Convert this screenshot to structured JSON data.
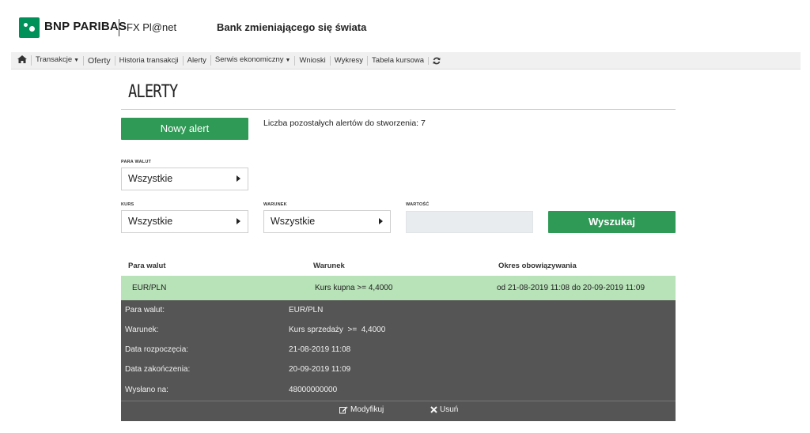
{
  "header": {
    "bank_name": "BNP PARIBAS",
    "product_name": "FX Pl@net",
    "tagline": "Bank zmieniającego się świata"
  },
  "nav": {
    "items": [
      {
        "label": "Transakcje",
        "dropdown": true
      },
      {
        "label": "Oferty",
        "dropdown": false
      },
      {
        "label": "Historia transakcji",
        "dropdown": false
      },
      {
        "label": "Alerty",
        "dropdown": false
      },
      {
        "label": "Serwis ekonomiczny",
        "dropdown": true
      },
      {
        "label": "Wnioski",
        "dropdown": false
      },
      {
        "label": "Wykresy",
        "dropdown": false
      },
      {
        "label": "Tabela kursowa",
        "dropdown": false
      }
    ]
  },
  "page": {
    "title": "ALERTY",
    "new_alert_button": "Nowy alert",
    "remaining_text": "Liczba pozostałych alertów do stworzenia: 7"
  },
  "filters": {
    "currency_pair": {
      "label": "PARA WALUT",
      "value": "Wszystkie"
    },
    "rate": {
      "label": "KURS",
      "value": "Wszystkie"
    },
    "condition": {
      "label": "WARUNEK",
      "value": "Wszystkie"
    },
    "value": {
      "label": "WARTOŚĆ",
      "value": ""
    },
    "search_button": "Wyszukaj"
  },
  "table": {
    "headers": [
      "Para walut",
      "Warunek",
      "Okres obowiązywania"
    ],
    "rows": [
      {
        "pair": "EUR/PLN",
        "condition": "Kurs kupna >= 4,4000",
        "period": "od 21-08-2019 11:08 do 20-09-2019 11:09"
      }
    ]
  },
  "details": {
    "fields": [
      {
        "label": "Para walut:",
        "value": "EUR/PLN"
      },
      {
        "label": "Warunek:",
        "value": "Kurs sprzedaży  >=  4,4000"
      },
      {
        "label": "Data rozpoczęcia:",
        "value": "21-08-2019 11:08"
      },
      {
        "label": "Data zakończenia:",
        "value": "20-09-2019 11:09"
      },
      {
        "label": "Wysłano na:",
        "value": "48000000000"
      }
    ],
    "modify_label": "Modyfikuj",
    "delete_label": "Usuń"
  },
  "colors": {
    "brand_green": "#00915a",
    "button_green": "#2e9a55",
    "selected_row": "#b8e2b8",
    "detail_panel": "#555555"
  }
}
